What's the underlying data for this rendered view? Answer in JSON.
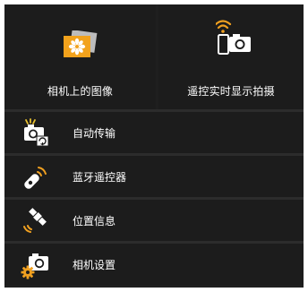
{
  "tiles": {
    "camera_images": {
      "label": "相机上的图像",
      "icon": "image-gallery-icon"
    },
    "remote_live_view": {
      "label": "遥控实时显示拍摄",
      "icon": "phone-camera-wifi-icon"
    }
  },
  "menu": [
    {
      "label": "自动传输",
      "icon": "auto-transfer-icon"
    },
    {
      "label": "蓝牙遥控器",
      "icon": "bluetooth-remote-icon"
    },
    {
      "label": "位置信息",
      "icon": "satellite-location-icon"
    },
    {
      "label": "相机设置",
      "icon": "camera-settings-icon"
    }
  ],
  "colors": {
    "background": "#1c1c1c",
    "text": "#ffffff",
    "accent_orange": "#f0a020",
    "accent_yellow": "#e8c030"
  }
}
